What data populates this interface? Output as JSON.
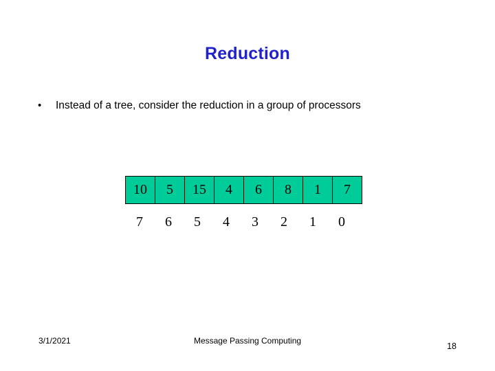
{
  "slide": {
    "title": "Reduction",
    "bullet": {
      "marker": "•",
      "text": "Instead of a tree, consider the reduction in a group of processors"
    },
    "table_top": {
      "cells": [
        "10",
        "5",
        "15",
        "4",
        "6",
        "8",
        "1",
        "7"
      ],
      "fill_color": "#00CC99",
      "border_color": "#000000"
    },
    "table_bottom": {
      "cells": [
        "7",
        "6",
        "5",
        "4",
        "3",
        "2",
        "1",
        "0"
      ]
    },
    "footer": {
      "date": "3/1/2021",
      "center": "Message Passing Computing",
      "page": "18"
    }
  }
}
